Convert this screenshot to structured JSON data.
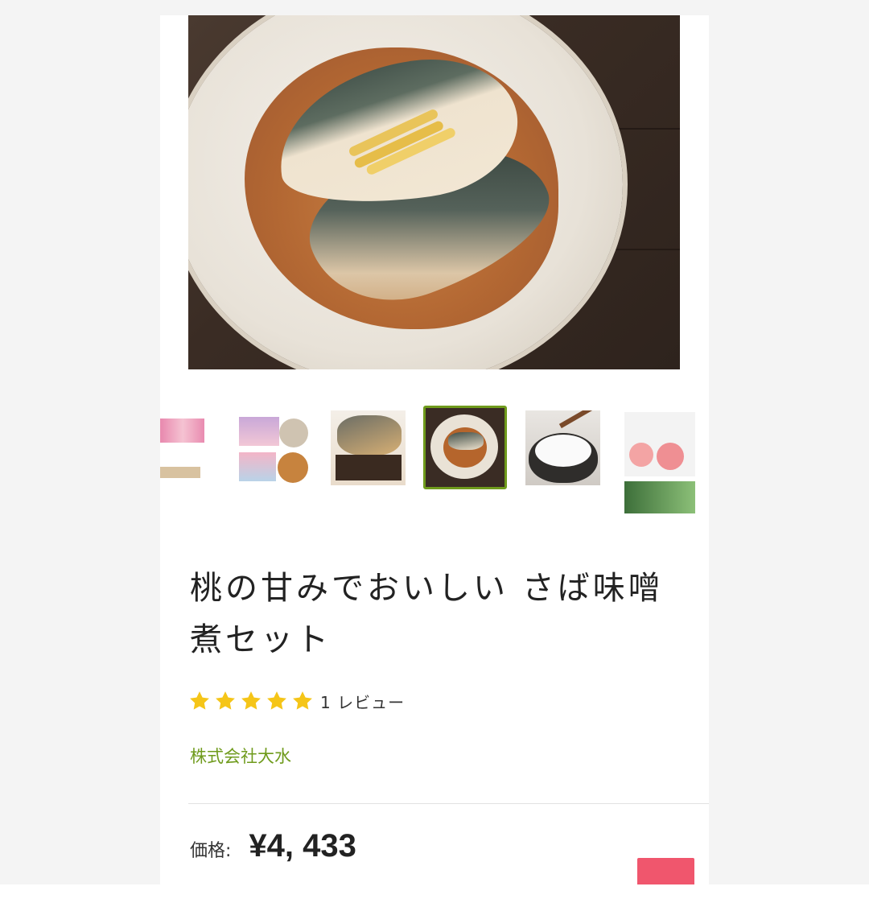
{
  "product": {
    "title": "桃の甘みでおいしい さば味噌煮セット",
    "rating": 5,
    "review_count_label": "1 レビュー",
    "seller": "株式会社大水",
    "price_label": "価格:",
    "price_value": "¥4, 433"
  },
  "gallery": {
    "selected_index": 3,
    "thumbnails": [
      {
        "name": "package-set"
      },
      {
        "name": "package-lineup"
      },
      {
        "name": "grilled-mackerel"
      },
      {
        "name": "mackerel-miso-plate"
      },
      {
        "name": "rice-bowl"
      },
      {
        "name": "peach-feature"
      }
    ]
  },
  "colors": {
    "accent_green": "#6f9b1c",
    "star_yellow": "#f5c518",
    "cta_pink": "#f0566d"
  }
}
